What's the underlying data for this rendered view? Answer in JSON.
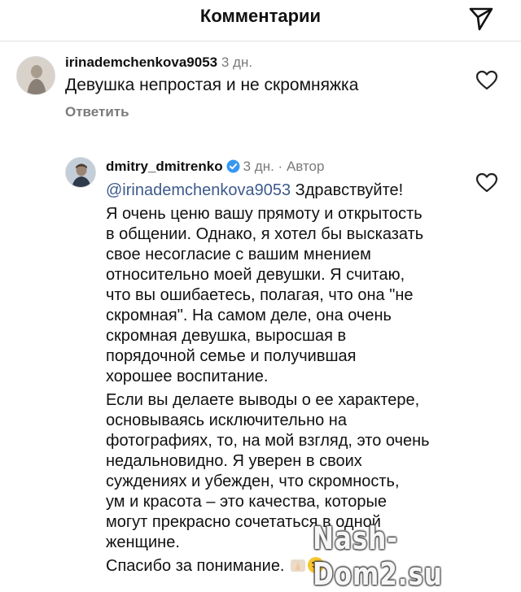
{
  "header": {
    "title": "Комментарии",
    "send_icon": "paper-plane-icon"
  },
  "comment1": {
    "username": "irinademchenkova9053",
    "time": "3 дн.",
    "text": "Девушка непростая и не скромняжка",
    "reply_label": "Ответить",
    "like_icon": "heart-icon"
  },
  "comment2": {
    "username": "dmitry_dmitrenko",
    "time": "3 дн.",
    "separator": "·",
    "author_label": "Автор",
    "mention": "@irinademchenkova9053",
    "greeting": "Здравствуйте!",
    "paragraph1": [
      "Я очень ценю вашу прямоту и открытость",
      "в общении. Однако, я хотел бы высказать",
      "свое несогласие с вашим мнением",
      "относительно моей девушки. Я считаю,",
      "что вы ошибаетесь, полагая, что она \"не",
      "скромная\". На самом деле, она очень",
      "скромная девушка, выросшая в",
      "порядочной семье и получившая",
      "хорошее воспитание."
    ],
    "paragraph2": [
      "Если вы делаете выводы о ее характере,",
      "основываясь исключительно на",
      "фотографиях, то, на мой взгляд, это очень",
      "недальновидно. Я уверен в своих",
      "суждениях и убежден, что скромность,",
      "ум и красота – это качества, которые",
      "могут прекрасно сочетаться в одной",
      "женщине."
    ],
    "closing": "Спасибо за понимание.",
    "like_icon": "heart-icon",
    "verified_icon": "verified-badge-icon"
  },
  "watermark": "Nash-Dom2.su"
}
